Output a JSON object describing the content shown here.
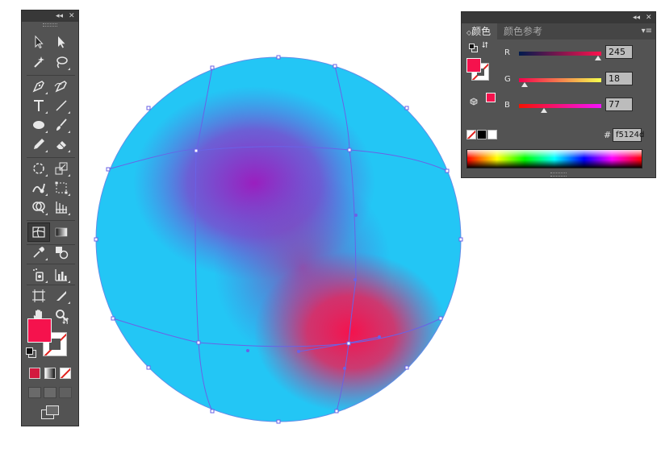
{
  "tools_panel": {
    "collapse_glyph": "◂◂",
    "close_glyph": "✕",
    "tools": [
      "selection-tool",
      "direct-selection-tool",
      "magic-wand-tool",
      "lasso-tool",
      "pen-tool",
      "curvature-tool",
      "type-tool",
      "line-segment-tool",
      "ellipse-tool",
      "paintbrush-tool",
      "pencil-tool",
      "eraser-tool",
      "rotate-tool",
      "scale-tool",
      "warp-tool",
      "free-transform-tool",
      "shape-builder-tool",
      "perspective-grid-tool",
      "mesh-tool",
      "gradient-tool",
      "eyedropper-tool",
      "blend-tool",
      "symbol-sprayer-tool",
      "column-graph-tool",
      "artboard-tool",
      "slice-tool",
      "hand-tool",
      "zoom-tool"
    ],
    "active_tool": "mesh-tool",
    "fill_color": "#f5124d",
    "stroke_color": "none"
  },
  "canvas": {
    "artwork": "gradient-mesh-sphere",
    "base_color": "#23c6f5",
    "mesh_color": "#7755e0",
    "blend_colors": [
      "#9a1fbf",
      "#f5124d"
    ]
  },
  "color_panel": {
    "collapse_glyph": "◂◂",
    "close_glyph": "✕",
    "tab_active": "颜色",
    "tab_inactive": "颜色参考",
    "tab_arrow": "◇",
    "menu_glyph": "▾≡",
    "channels": [
      {
        "label": "R",
        "value": "245",
        "fraction": 0.961
      },
      {
        "label": "G",
        "value": "18",
        "fraction": 0.071
      },
      {
        "label": "B",
        "value": "77",
        "fraction": 0.302
      }
    ],
    "hex_prefix": "#",
    "hex": "f5124d",
    "fill_color": "#f5124d",
    "swatches": [
      "none",
      "#000000",
      "#ffffff"
    ]
  }
}
